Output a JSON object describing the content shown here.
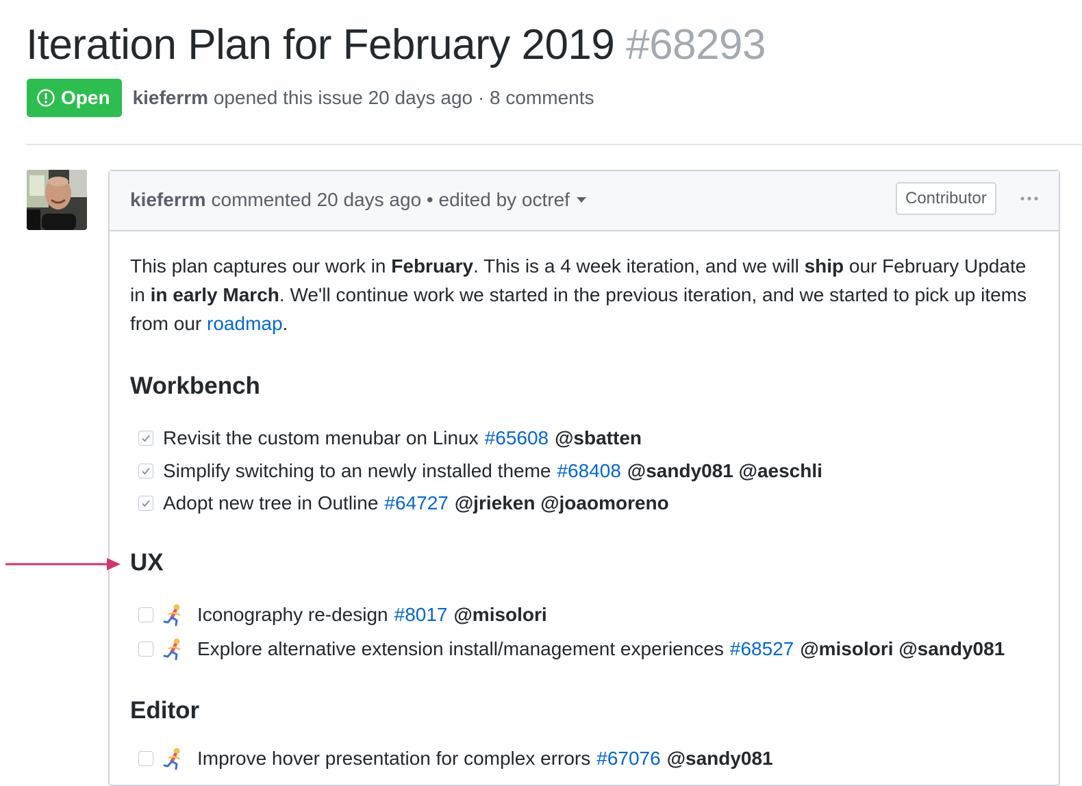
{
  "issue": {
    "title": "Iteration Plan for February 2019",
    "number": "#68293",
    "state": "Open",
    "author": "kieferrm",
    "meta_suffix": "opened this issue 20 days ago · 8 comments"
  },
  "comment": {
    "author": "kieferrm",
    "meta": "commented 20 days ago • edited by octref",
    "badge": "Contributor",
    "intro": {
      "t1": "This plan captures our work in ",
      "b1": "February",
      "t2": ". This is a 4 week iteration, and we will ",
      "b2": "ship",
      "t3": " our February Update in ",
      "b3": "in early March",
      "t4": ". We'll continue work we started in the previous iteration, and we started to pick up items from our ",
      "link": "roadmap",
      "t5": "."
    },
    "sections": [
      {
        "heading": "Workbench",
        "tasks": [
          {
            "checked": true,
            "text": "Revisit the custom menubar on Linux",
            "issue": "#65608",
            "mentions": "@sbatten"
          },
          {
            "checked": true,
            "text": "Simplify switching to an newly installed theme",
            "issue": "#68408",
            "mentions": "@sandy081 @aeschli"
          },
          {
            "checked": true,
            "text": "Adopt new tree in Outline",
            "issue": "#64727",
            "mentions": "@jrieken @joaomoreno"
          }
        ]
      },
      {
        "heading": "UX",
        "tasks": [
          {
            "checked": false,
            "icon": "runner-emoji-icon",
            "text": "Iconography re-design",
            "issue": "#8017",
            "mentions": "@misolori"
          },
          {
            "checked": false,
            "icon": "runner-emoji-icon",
            "text": "Explore alternative extension install/management experiences",
            "issue": "#68527",
            "mentions": "@misolori @sandy081"
          }
        ]
      },
      {
        "heading": "Editor",
        "tasks": [
          {
            "checked": false,
            "icon": "runner-emoji-icon",
            "text": "Improve hover presentation for complex errors",
            "issue": "#67076",
            "mentions": "@sandy081"
          }
        ]
      }
    ]
  },
  "colors": {
    "open_badge": "#2cbe4e",
    "link": "#0366d6",
    "annotation_arrow": "#d6336c"
  }
}
